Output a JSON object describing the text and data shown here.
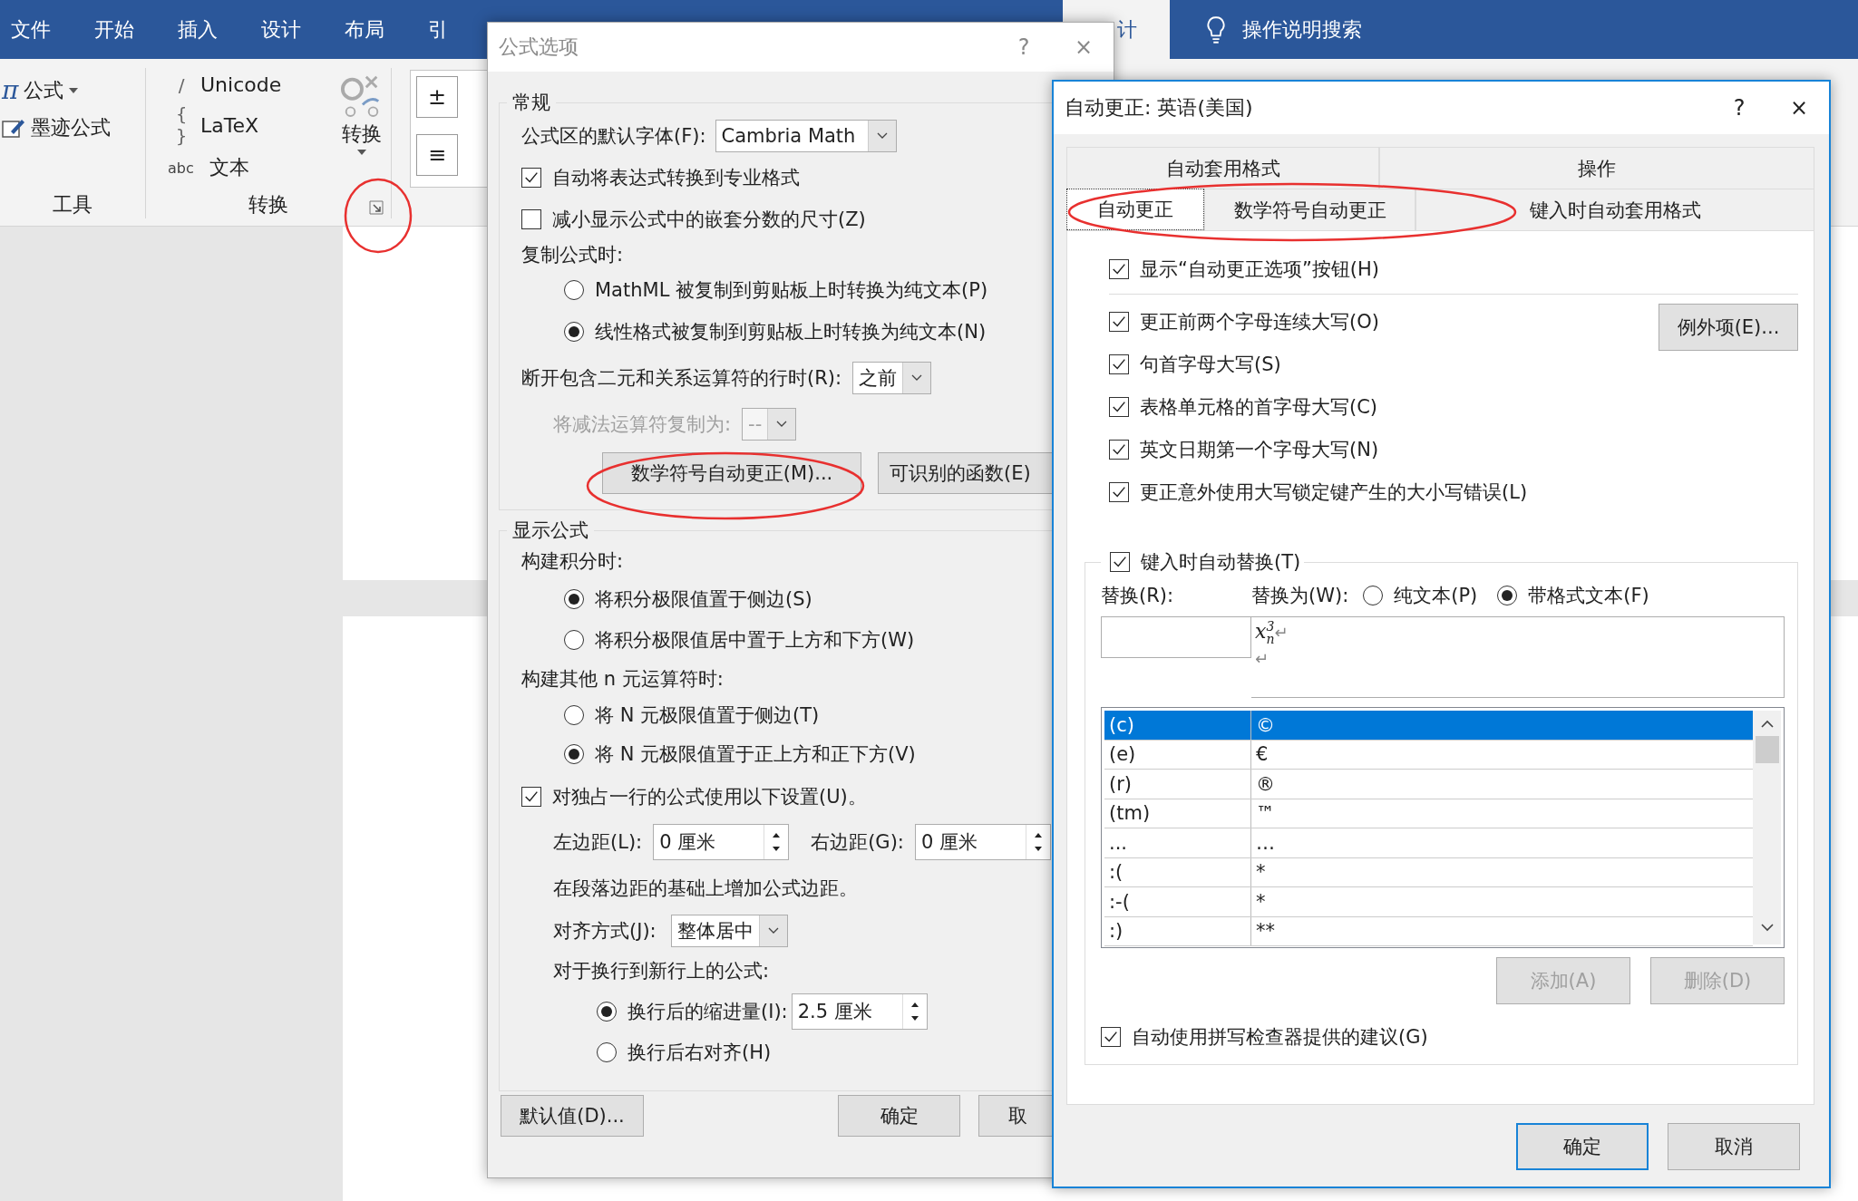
{
  "word": {
    "tabs": [
      {
        "label": "文件",
        "selected": false
      },
      {
        "label": "开始",
        "selected": false
      },
      {
        "label": "插入",
        "selected": false
      },
      {
        "label": "设计",
        "selected": false
      },
      {
        "label": "布局",
        "selected": false
      },
      {
        "label": "引",
        "selected": false
      },
      {
        "label": "计",
        "selected": true
      }
    ],
    "search": "操作说明搜索",
    "tools_group": {
      "label": "工具",
      "pi": "π",
      "equation": "公式",
      "ink": "墨迹公式"
    },
    "convert_group": {
      "label": "转换",
      "unicode_mark": "/",
      "unicode": "Unicode",
      "latex_mark": "{ }",
      "latex": "LaTeX",
      "abc": "abc",
      "text": "文本",
      "button": "转换"
    },
    "gallery": [
      "±",
      "≡"
    ]
  },
  "equation_options": {
    "title": "公式选项",
    "help": "?",
    "close": "×",
    "general": {
      "legend": "常规",
      "font_label": "公式区的默认字体(F):",
      "font_value": "Cambria Math",
      "options": [
        {
          "label": "自动将表达式转换到专业格式",
          "checked": true
        },
        {
          "label": "减小显示公式中的嵌套分数的尺寸(Z)",
          "checked": false
        }
      ],
      "copy_label": "复制公式时:",
      "copy_options": [
        {
          "label": "MathML 被复制到剪贴板上时转换为纯文本(P)",
          "selected": false
        },
        {
          "label": "线性格式被复制到剪贴板上时转换为纯文本(N)",
          "selected": true
        }
      ],
      "break_label": "断开包含二元和关系运算符的行时(R):",
      "break_value": "之前",
      "minus_label": "将减法运算符复制为:",
      "minus_value": "--",
      "minus_disabled": true,
      "buttons": [
        "数学符号自动更正(M)...",
        "可识别的函数(E)"
      ]
    },
    "display": {
      "legend": "显示公式",
      "integral_label": "构建积分时:",
      "integral_options": [
        {
          "label": "将积分极限值置于侧边(S)",
          "selected": true
        },
        {
          "label": "将积分极限值居中置于上方和下方(W)",
          "selected": false
        }
      ],
      "nary_label": "构建其他 n 元运算符时:",
      "nary_options": [
        {
          "label": "将 N 元极限值置于侧边(T)",
          "selected": false
        },
        {
          "label": "将 N 元极限值置于正上方和正下方(V)",
          "selected": true
        }
      ],
      "own_line": {
        "label": "对独占一行的公式使用以下设置(U)。",
        "checked": true
      },
      "left_label": "左边距(L):",
      "left_value": "0 厘米",
      "right_label": "右边距(G):",
      "right_value": "0 厘米",
      "note": "在段落边距的基础上增加公式边距。",
      "align_label": "对齐方式(J):",
      "align_value": "整体居中",
      "wrap_label": "对于换行到新行上的公式:",
      "wrap_options": [
        {
          "label": "换行后的缩进量(I):",
          "selected": true,
          "value": "2.5 厘米"
        },
        {
          "label": "换行后右对齐(H)",
          "selected": false
        }
      ]
    },
    "footer": [
      "默认值(D)...",
      "确定",
      "取"
    ]
  },
  "autocorrect": {
    "title": "自动更正: 英语(美国)",
    "help": "?",
    "close": "×",
    "tabs_top": [
      {
        "label": "自动套用格式",
        "selected": false
      },
      {
        "label": "操作",
        "selected": false
      }
    ],
    "tabs_bottom": [
      {
        "label": "自动更正",
        "selected": true
      },
      {
        "label": "数学符号自动更正",
        "selected": false
      },
      {
        "label": "键入时自动套用格式",
        "selected": false
      }
    ],
    "show_button": {
      "label": "显示“自动更正选项”按钮(H)",
      "checked": true
    },
    "exceptions": "例外项(E)...",
    "rules": [
      {
        "label": "更正前两个字母连续大写(O)",
        "checked": true
      },
      {
        "label": "句首字母大写(S)",
        "checked": true
      },
      {
        "label": "表格单元格的首字母大写(C)",
        "checked": true
      },
      {
        "label": "英文日期第一个字母大写(N)",
        "checked": true
      },
      {
        "label": "更正意外使用大写锁定键产生的大小写错误(L)",
        "checked": true
      }
    ],
    "replace": {
      "label": "键入时自动替换(T)",
      "checked": true,
      "replace_label": "替换(R):",
      "with_label": "替换为(W):",
      "modes": [
        {
          "label": "纯文本(P)",
          "selected": false
        },
        {
          "label": "带格式文本(F)",
          "selected": true
        }
      ],
      "with_value": {
        "base": "x",
        "sup": "3",
        "sub": "n"
      },
      "paragraph_marks": [
        "↵",
        "↵"
      ],
      "entries": [
        {
          "from": "(c)",
          "to": "©",
          "selected": true
        },
        {
          "from": "(e)",
          "to": "€",
          "selected": false
        },
        {
          "from": "(r)",
          "to": "®",
          "selected": false
        },
        {
          "from": "(tm)",
          "to": "™",
          "selected": false
        },
        {
          "from": "...",
          "to": "…",
          "selected": false
        },
        {
          "from": ":(",
          "to": "*",
          "selected": false
        },
        {
          "from": ":-(",
          "to": "*",
          "selected": false
        },
        {
          "from": ":)",
          "to": "**",
          "selected": false
        }
      ],
      "add": {
        "label": "添加(A)",
        "disabled": true
      },
      "delete": {
        "label": "删除(D)",
        "disabled": true
      },
      "spell": {
        "label": "自动使用拼写检查器提供的建议(G)",
        "checked": true
      }
    },
    "footer": [
      {
        "label": "确定",
        "default": true
      },
      {
        "label": "取消",
        "default": false
      }
    ]
  }
}
